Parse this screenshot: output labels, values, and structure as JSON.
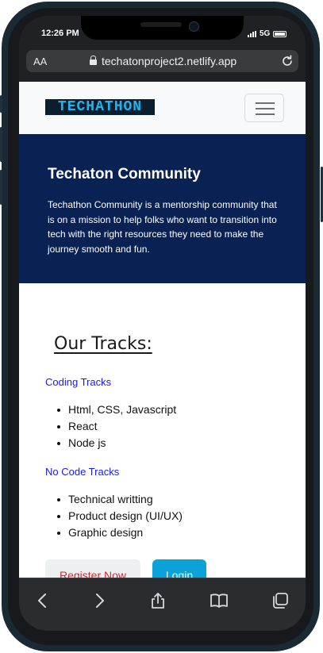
{
  "status_bar": {
    "time": "12:26 PM",
    "network": "5G"
  },
  "browser": {
    "aa_label": "AA",
    "url": "techatonproject2.netlify.app"
  },
  "navbar": {
    "logo_text": "TECHATHON"
  },
  "hero": {
    "title": "Techaton Community",
    "description": "Techathon Community is a mentorship community that is on a mission to help folks who want to transition into tech with the right resources they need to make the journey smooth and fun."
  },
  "tracks": {
    "heading": "Our Tracks:",
    "groups": [
      {
        "label": "Coding Tracks",
        "items": [
          "Html, CSS, Javascript",
          "React",
          "Node js"
        ]
      },
      {
        "label": "No Code Tracks",
        "items": [
          "Technical writting",
          "Product design (UI/UX)",
          "Graphic design"
        ]
      }
    ]
  },
  "actions": {
    "register_label": "Register Now",
    "login_label": "Login"
  },
  "colors": {
    "hero_bg": "#0a2153",
    "link": "#1a1aee",
    "register_text": "#e0242c",
    "login_bg": "#0aa2d8"
  },
  "toolbar_icons": [
    "back-icon",
    "forward-icon",
    "share-icon",
    "bookmarks-icon",
    "tabs-icon"
  ]
}
